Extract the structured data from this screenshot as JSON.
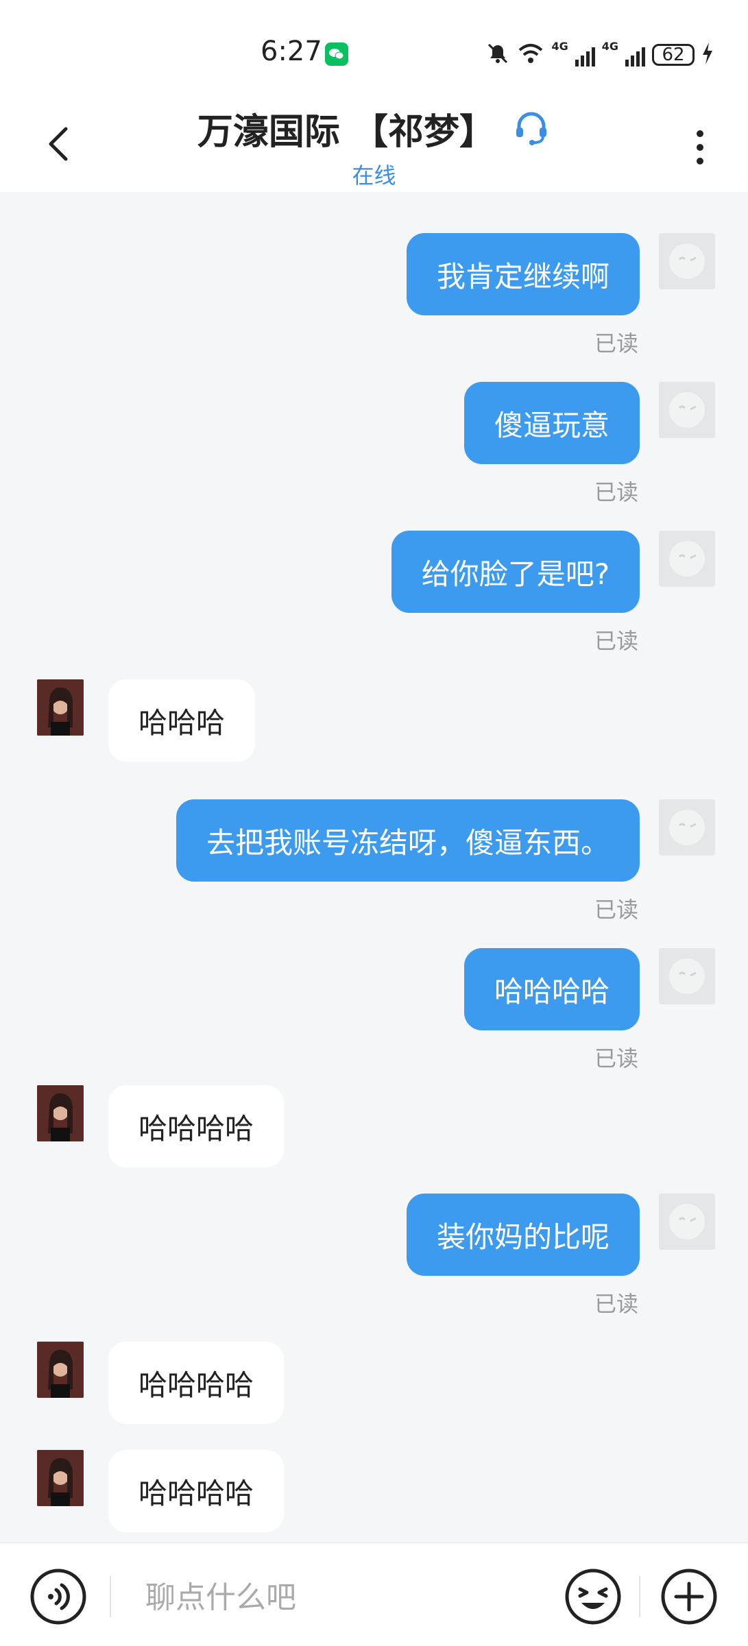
{
  "status_bar": {
    "time": "6:27",
    "network_label_1": "4G",
    "network_label_2": "4G",
    "battery": "62"
  },
  "header": {
    "title": "万濠国际 【祁梦】",
    "subtitle": "在线",
    "accent_color": "#3a8ee6"
  },
  "messages": [
    {
      "from": "me",
      "text": "我肯定继续啊",
      "status": "已读"
    },
    {
      "from": "me",
      "text": "傻逼玩意",
      "status": "已读"
    },
    {
      "from": "me",
      "text": "给你脸了是吧?",
      "status": "已读"
    },
    {
      "from": "other",
      "text": "哈哈哈"
    },
    {
      "from": "me",
      "text": "去把我账号冻结呀，傻逼东西。",
      "status": "已读"
    },
    {
      "from": "me",
      "text": "哈哈哈哈",
      "status": "已读"
    },
    {
      "from": "other",
      "text": "哈哈哈哈"
    },
    {
      "from": "me",
      "text": "装你妈的比呢",
      "status": "已读"
    },
    {
      "from": "other",
      "text": "哈哈哈哈"
    },
    {
      "from": "other",
      "text": "哈哈哈哈"
    }
  ],
  "input": {
    "placeholder": "聊点什么吧"
  },
  "colors": {
    "my_bubble": "#3c9aef",
    "their_bubble": "#ffffff",
    "background": "#f4f6f8"
  }
}
